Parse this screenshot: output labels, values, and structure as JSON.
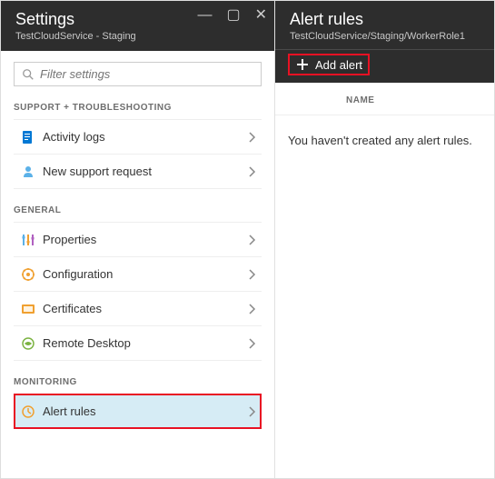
{
  "left": {
    "title": "Settings",
    "subtitle": "TestCloudService - Staging",
    "search_placeholder": "Filter settings",
    "sections": {
      "support": {
        "label": "SUPPORT + TROUBLESHOOTING",
        "items": [
          {
            "label": "Activity logs"
          },
          {
            "label": "New support request"
          }
        ]
      },
      "general": {
        "label": "GENERAL",
        "items": [
          {
            "label": "Properties"
          },
          {
            "label": "Configuration"
          },
          {
            "label": "Certificates"
          },
          {
            "label": "Remote Desktop"
          }
        ]
      },
      "monitoring": {
        "label": "MONITORING",
        "items": [
          {
            "label": "Alert rules"
          }
        ]
      }
    }
  },
  "right": {
    "title": "Alert rules",
    "subtitle": "TestCloudService/Staging/WorkerRole1",
    "add_label": "Add alert",
    "col_name": "NAME",
    "empty": "You haven't created any alert rules."
  }
}
